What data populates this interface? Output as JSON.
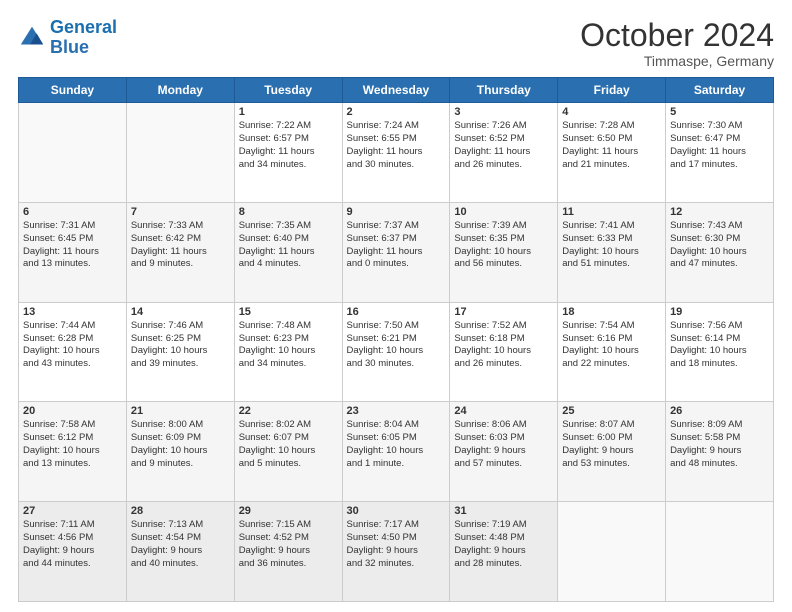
{
  "logo": {
    "line1": "General",
    "line2": "Blue"
  },
  "header": {
    "month": "October 2024",
    "location": "Timmaspe, Germany"
  },
  "weekdays": [
    "Sunday",
    "Monday",
    "Tuesday",
    "Wednesday",
    "Thursday",
    "Friday",
    "Saturday"
  ],
  "weeks": [
    [
      {
        "day": "",
        "content": ""
      },
      {
        "day": "",
        "content": ""
      },
      {
        "day": "1",
        "content": "Sunrise: 7:22 AM\nSunset: 6:57 PM\nDaylight: 11 hours\nand 34 minutes."
      },
      {
        "day": "2",
        "content": "Sunrise: 7:24 AM\nSunset: 6:55 PM\nDaylight: 11 hours\nand 30 minutes."
      },
      {
        "day": "3",
        "content": "Sunrise: 7:26 AM\nSunset: 6:52 PM\nDaylight: 11 hours\nand 26 minutes."
      },
      {
        "day": "4",
        "content": "Sunrise: 7:28 AM\nSunset: 6:50 PM\nDaylight: 11 hours\nand 21 minutes."
      },
      {
        "day": "5",
        "content": "Sunrise: 7:30 AM\nSunset: 6:47 PM\nDaylight: 11 hours\nand 17 minutes."
      }
    ],
    [
      {
        "day": "6",
        "content": "Sunrise: 7:31 AM\nSunset: 6:45 PM\nDaylight: 11 hours\nand 13 minutes."
      },
      {
        "day": "7",
        "content": "Sunrise: 7:33 AM\nSunset: 6:42 PM\nDaylight: 11 hours\nand 9 minutes."
      },
      {
        "day": "8",
        "content": "Sunrise: 7:35 AM\nSunset: 6:40 PM\nDaylight: 11 hours\nand 4 minutes."
      },
      {
        "day": "9",
        "content": "Sunrise: 7:37 AM\nSunset: 6:37 PM\nDaylight: 11 hours\nand 0 minutes."
      },
      {
        "day": "10",
        "content": "Sunrise: 7:39 AM\nSunset: 6:35 PM\nDaylight: 10 hours\nand 56 minutes."
      },
      {
        "day": "11",
        "content": "Sunrise: 7:41 AM\nSunset: 6:33 PM\nDaylight: 10 hours\nand 51 minutes."
      },
      {
        "day": "12",
        "content": "Sunrise: 7:43 AM\nSunset: 6:30 PM\nDaylight: 10 hours\nand 47 minutes."
      }
    ],
    [
      {
        "day": "13",
        "content": "Sunrise: 7:44 AM\nSunset: 6:28 PM\nDaylight: 10 hours\nand 43 minutes."
      },
      {
        "day": "14",
        "content": "Sunrise: 7:46 AM\nSunset: 6:25 PM\nDaylight: 10 hours\nand 39 minutes."
      },
      {
        "day": "15",
        "content": "Sunrise: 7:48 AM\nSunset: 6:23 PM\nDaylight: 10 hours\nand 34 minutes."
      },
      {
        "day": "16",
        "content": "Sunrise: 7:50 AM\nSunset: 6:21 PM\nDaylight: 10 hours\nand 30 minutes."
      },
      {
        "day": "17",
        "content": "Sunrise: 7:52 AM\nSunset: 6:18 PM\nDaylight: 10 hours\nand 26 minutes."
      },
      {
        "day": "18",
        "content": "Sunrise: 7:54 AM\nSunset: 6:16 PM\nDaylight: 10 hours\nand 22 minutes."
      },
      {
        "day": "19",
        "content": "Sunrise: 7:56 AM\nSunset: 6:14 PM\nDaylight: 10 hours\nand 18 minutes."
      }
    ],
    [
      {
        "day": "20",
        "content": "Sunrise: 7:58 AM\nSunset: 6:12 PM\nDaylight: 10 hours\nand 13 minutes."
      },
      {
        "day": "21",
        "content": "Sunrise: 8:00 AM\nSunset: 6:09 PM\nDaylight: 10 hours\nand 9 minutes."
      },
      {
        "day": "22",
        "content": "Sunrise: 8:02 AM\nSunset: 6:07 PM\nDaylight: 10 hours\nand 5 minutes."
      },
      {
        "day": "23",
        "content": "Sunrise: 8:04 AM\nSunset: 6:05 PM\nDaylight: 10 hours\nand 1 minute."
      },
      {
        "day": "24",
        "content": "Sunrise: 8:06 AM\nSunset: 6:03 PM\nDaylight: 9 hours\nand 57 minutes."
      },
      {
        "day": "25",
        "content": "Sunrise: 8:07 AM\nSunset: 6:00 PM\nDaylight: 9 hours\nand 53 minutes."
      },
      {
        "day": "26",
        "content": "Sunrise: 8:09 AM\nSunset: 5:58 PM\nDaylight: 9 hours\nand 48 minutes."
      }
    ],
    [
      {
        "day": "27",
        "content": "Sunrise: 7:11 AM\nSunset: 4:56 PM\nDaylight: 9 hours\nand 44 minutes."
      },
      {
        "day": "28",
        "content": "Sunrise: 7:13 AM\nSunset: 4:54 PM\nDaylight: 9 hours\nand 40 minutes."
      },
      {
        "day": "29",
        "content": "Sunrise: 7:15 AM\nSunset: 4:52 PM\nDaylight: 9 hours\nand 36 minutes."
      },
      {
        "day": "30",
        "content": "Sunrise: 7:17 AM\nSunset: 4:50 PM\nDaylight: 9 hours\nand 32 minutes."
      },
      {
        "day": "31",
        "content": "Sunrise: 7:19 AM\nSunset: 4:48 PM\nDaylight: 9 hours\nand 28 minutes."
      },
      {
        "day": "",
        "content": ""
      },
      {
        "day": "",
        "content": ""
      }
    ]
  ]
}
